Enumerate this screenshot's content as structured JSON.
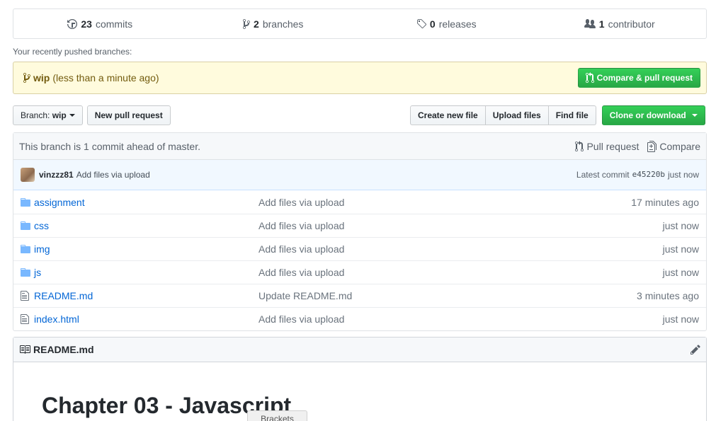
{
  "summary": {
    "commits_count": "23",
    "commits_label": "commits",
    "branches_count": "2",
    "branches_label": "branches",
    "releases_count": "0",
    "releases_label": "releases",
    "contributors_count": "1",
    "contributors_label": "contributor"
  },
  "recent": {
    "label": "Your recently pushed branches:",
    "branch": "wip",
    "ago": "(less than a minute ago)",
    "compare_button": "Compare & pull request"
  },
  "toolbar": {
    "branch_prefix": "Branch:",
    "branch_name": "wip",
    "new_pr": "New pull request",
    "create_file": "Create new file",
    "upload_files": "Upload files",
    "find_file": "Find file",
    "clone": "Clone or download"
  },
  "ahead": {
    "text": "This branch is 1 commit ahead of master.",
    "pull_request": "Pull request",
    "compare": "Compare"
  },
  "commit": {
    "author": "vinzzz81",
    "message": "Add files via upload",
    "latest_label": "Latest commit",
    "sha": "e45220b",
    "time": "just now"
  },
  "files": [
    {
      "type": "dir",
      "name": "assignment",
      "message": "Add files via upload",
      "age": "17 minutes ago"
    },
    {
      "type": "dir",
      "name": "css",
      "message": "Add files via upload",
      "age": "just now"
    },
    {
      "type": "dir",
      "name": "img",
      "message": "Add files via upload",
      "age": "just now"
    },
    {
      "type": "dir",
      "name": "js",
      "message": "Add files via upload",
      "age": "just now"
    },
    {
      "type": "file",
      "name": "README.md",
      "message": "Update README.md",
      "age": "3 minutes ago"
    },
    {
      "type": "file",
      "name": "index.html",
      "message": "Add files via upload",
      "age": "just now"
    }
  ],
  "readme": {
    "filename": "README.md",
    "heading": "Chapter 03 - Javascript"
  },
  "tooltip": {
    "text": "Brackets"
  },
  "colors": {
    "link": "#0366d6",
    "green": "#28a745",
    "notice_bg": "#fffbdd"
  }
}
